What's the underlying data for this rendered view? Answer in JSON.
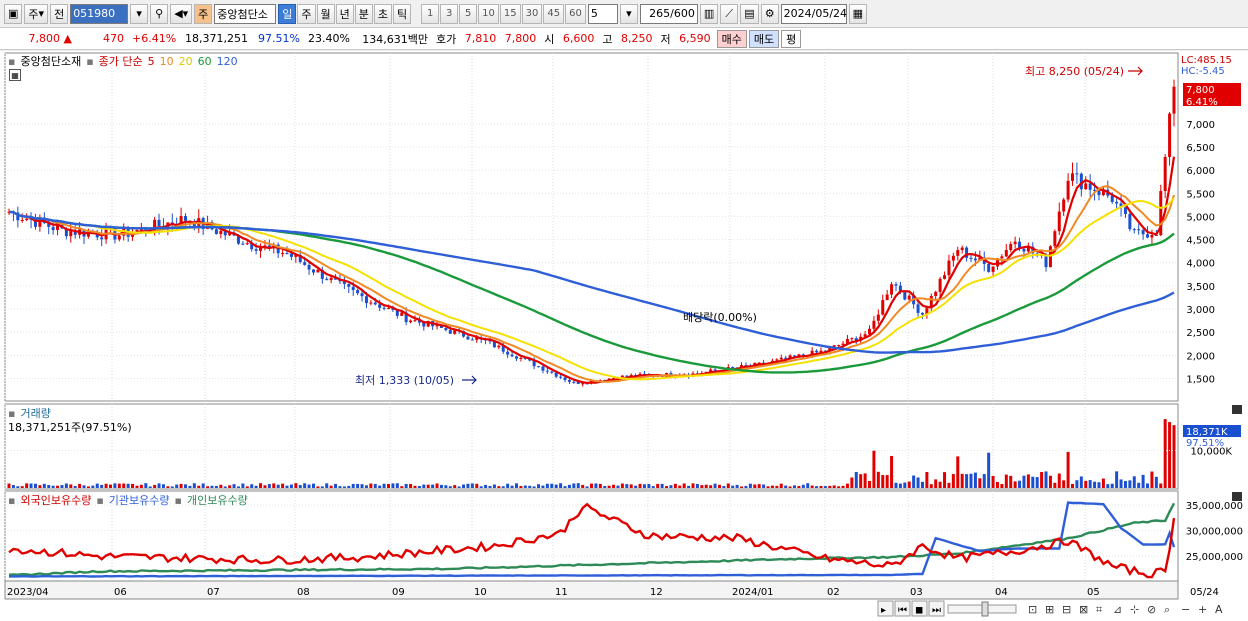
{
  "toolbar": {
    "type_label": "주",
    "prev_label": "전",
    "code": "051980",
    "stock_name_tag": "주",
    "stock_name": "중앙첨단소",
    "periods": [
      {
        "label": "일",
        "selected": true
      },
      {
        "label": "주",
        "selected": false
      },
      {
        "label": "월",
        "selected": false
      },
      {
        "label": "년",
        "selected": false
      },
      {
        "label": "분",
        "selected": false
      },
      {
        "label": "초",
        "selected": false
      },
      {
        "label": "틱",
        "selected": false
      }
    ],
    "intervals": [
      "1",
      "3",
      "5",
      "10",
      "15",
      "30",
      "45",
      "60"
    ],
    "interval_value": "5",
    "count": "265",
    "count_total": "/600",
    "date": "2024/05/24"
  },
  "quote": {
    "price": "7,800",
    "arrow": "▲",
    "change": "470",
    "change_pct": "+6.41%",
    "volume": "18,371,251",
    "volume_ratio": "97.51%",
    "turnover": "23.40%",
    "amount": "134,631백만",
    "hoga_label": "호가",
    "ask": "7,810",
    "bid": "7,800",
    "open_label": "시",
    "open": "6,600",
    "high_label": "고",
    "high": "8,250",
    "low_label": "저",
    "low": "6,590",
    "buy_label": "매수",
    "sell_label": "매도",
    "eval_label": "평"
  },
  "price_panel": {
    "legend_name": "중앙첨단소재",
    "legend_ma": "종가 단순",
    "ma_periods": [
      "5",
      "10",
      "20",
      "60",
      "120"
    ],
    "lc": "LC:485.15",
    "hc": "HC:-5.45",
    "cur_price_tag": "7,800",
    "cur_pct_tag": "6.41%",
    "high_note": "최고 8,250 (05/24)",
    "low_note": "최저 1,333 (10/05)",
    "dividend_note": "배당락(0.00%)",
    "yticks": [
      "7,000",
      "6,500",
      "6,000",
      "5,500",
      "5,000",
      "4,500",
      "4,000",
      "3,500",
      "3,000",
      "2,500",
      "2,000",
      "1,500"
    ]
  },
  "volume_panel": {
    "title": "거래량",
    "value": "18,371,251주(97.51%)",
    "tag_value": "18,371K",
    "tag_pct": "97.51%",
    "yticks": [
      "10,000K"
    ]
  },
  "holdings_panel": {
    "legend": [
      "외국인보유수량",
      "기관보유수량",
      "개인보유수량"
    ],
    "yticks": [
      "35,000,000",
      "30,000,000",
      "25,000,000"
    ]
  },
  "xaxis": [
    "2023/04",
    "06",
    "07",
    "08",
    "09",
    "10",
    "11",
    "12",
    "2024/01",
    "02",
    "03",
    "04",
    "05",
    "05/24"
  ],
  "colors": {
    "up": "#e00000",
    "down": "#1a4fd0",
    "ma5": "#e00000",
    "ma10": "#f08a24",
    "ma20": "#f5e100",
    "ma60": "#1a9a3a",
    "ma120": "#2f5fd8",
    "foreign": "#e00000",
    "institution": "#2f5fd8",
    "individual": "#2e8b57"
  }
}
